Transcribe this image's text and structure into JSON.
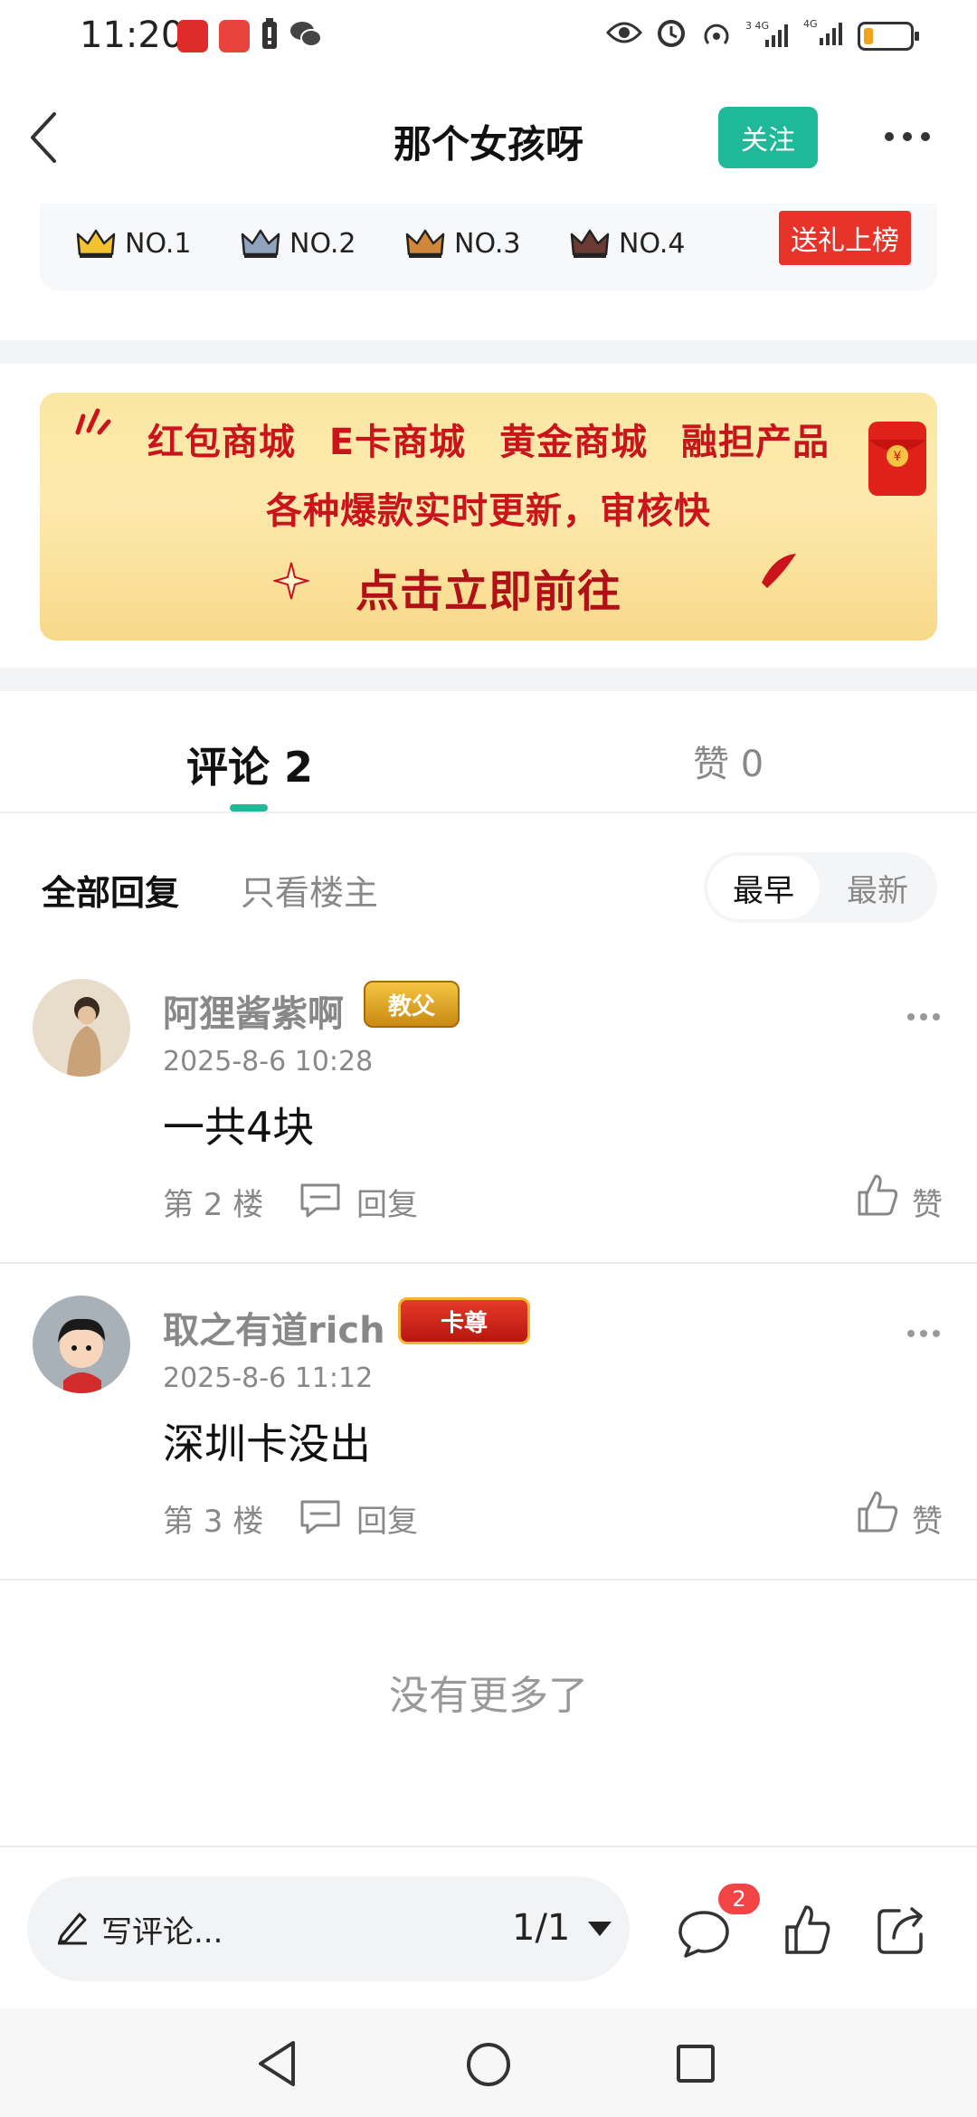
{
  "status_bar": {
    "time": "11:20",
    "network": "3 4G 4G",
    "app_icons": [
      "red-app-icon",
      "huawei-app-icon",
      "battery-saver-icon",
      "wechat-icon"
    ],
    "system_icons": [
      "eye-icon",
      "alarm-icon",
      "hotspot-icon",
      "signal-icon",
      "signal-icon",
      "battery-icon"
    ]
  },
  "header": {
    "title": "那个女孩呀",
    "follow_label": "关注"
  },
  "rank": {
    "items": [
      {
        "label": "NO.1",
        "color": "#f2c230"
      },
      {
        "label": "NO.2",
        "color": "#8fa3bd"
      },
      {
        "label": "NO.3",
        "color": "#d1873a"
      },
      {
        "label": "NO.4",
        "color": "#6b3a32"
      }
    ],
    "gift_label": "送礼上榜"
  },
  "banner": {
    "line1": "红包商城 E卡商城 黄金商城 融担产品",
    "line2": "各种爆款实时更新，审核快",
    "line3": "点击立即前往"
  },
  "tabs": {
    "comments": "评论 2",
    "likes": "赞 0"
  },
  "filters": {
    "all": "全部回复",
    "op_only": "只看楼主",
    "sort_earliest": "最早",
    "sort_latest": "最新"
  },
  "comments": [
    {
      "user": "阿狸酱紫啊",
      "badge": "教父",
      "time": "2025-8-6 10:28",
      "text": "一共4块",
      "floor": "第 2 楼",
      "reply_label": "回复",
      "like_label": "赞"
    },
    {
      "user": "取之有道rich",
      "badge": "卡尊",
      "time": "2025-8-6 11:12",
      "text": "深圳卡没出",
      "floor": "第 3 楼",
      "reply_label": "回复",
      "like_label": "赞"
    }
  ],
  "footer": {
    "no_more": "没有更多了"
  },
  "bottom_bar": {
    "placeholder": "写评论...",
    "page": "1/1",
    "comment_count": "2"
  },
  "colors": {
    "accent": "#1fb999",
    "gift": "#e8332b",
    "badge_red": "#f24444"
  }
}
